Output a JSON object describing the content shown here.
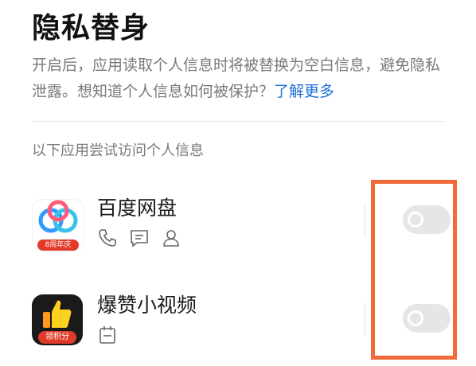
{
  "page": {
    "title": "隐私替身",
    "description": "开启后，应用读取个人信息时将被替换为空白信息，避免隐私泄露。想知道个人信息如何被保护？",
    "learn_more": "了解更多",
    "section_label": "以下应用尝试访问个人信息"
  },
  "apps": [
    {
      "name": "百度网盘",
      "badge": "8周年庆",
      "permissions": [
        "phone-icon",
        "message-icon",
        "contact-icon"
      ],
      "toggle_on": false
    },
    {
      "name": "爆赞小视频",
      "badge": "领积分",
      "permissions": [
        "calendar-icon"
      ],
      "toggle_on": false
    }
  ],
  "colors": {
    "link": "#1e6fd9",
    "highlight": "#f26a3a",
    "toggle_off": "#e6e6e6"
  }
}
